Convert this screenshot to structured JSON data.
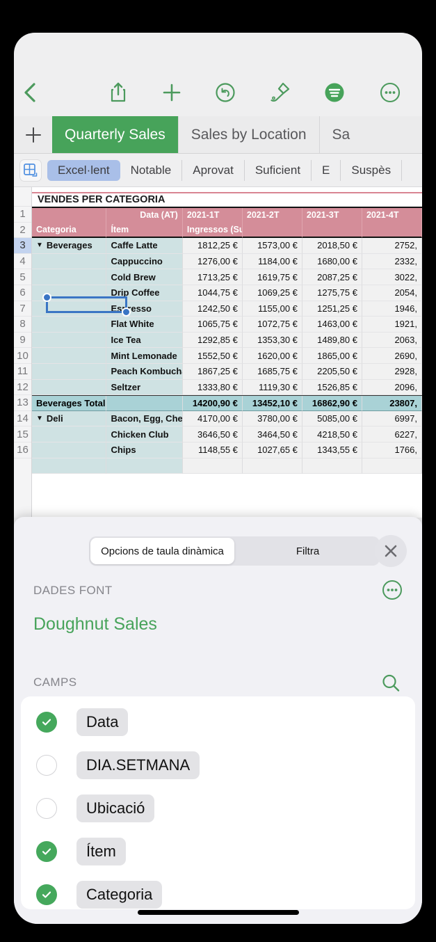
{
  "toolbar": {
    "back_icon": "chevron-left-icon",
    "share_icon": "share-icon",
    "add_icon": "plus-icon",
    "undo_icon": "undo-icon",
    "brush_icon": "paintbrush-icon",
    "format_icon": "format-icon",
    "more_icon": "more-circle-icon"
  },
  "sheet_tabs": {
    "add_label": "+",
    "tabs": [
      {
        "label": "Quarterly Sales",
        "active": true
      },
      {
        "label": "Sales by Location",
        "active": false
      },
      {
        "label": "Sa",
        "active": false
      }
    ]
  },
  "style_bar": {
    "table_icon": "table-insert-icon",
    "styles": [
      {
        "label": "Excel·lent",
        "selected": true
      },
      {
        "label": "Notable",
        "selected": false
      },
      {
        "label": "Aprovat",
        "selected": false
      },
      {
        "label": "Suficient",
        "selected": false
      },
      {
        "label": "E",
        "selected": false
      },
      {
        "label": "Suspès",
        "selected": false
      }
    ]
  },
  "spreadsheet": {
    "title": "VENDES PER CATEGORIA",
    "row_numbers": [
      "1",
      "2",
      "3",
      "4",
      "5",
      "6",
      "7",
      "8",
      "9",
      "10",
      "11",
      "12",
      "13",
      "14",
      "15",
      "16"
    ],
    "selected_row": "3",
    "header_row_1": {
      "data_label": "Data (AT)",
      "quarters": [
        "2021-1T",
        "2021-2T",
        "2021-3T",
        "2021-4T"
      ]
    },
    "header_row_2": {
      "category": "Categoria",
      "item": "Ítem",
      "measure": "Ingressos (Suma)"
    },
    "rows": [
      {
        "type": "group",
        "category": "Beverages",
        "item": "Caffe Latte",
        "values": [
          "1812,25 €",
          "1573,00 €",
          "2018,50 €",
          "2752,"
        ]
      },
      {
        "type": "data",
        "category": "",
        "item": "Cappuccino",
        "values": [
          "1276,00 €",
          "1184,00 €",
          "1680,00 €",
          "2332,"
        ]
      },
      {
        "type": "data",
        "category": "",
        "item": "Cold Brew",
        "values": [
          "1713,25 €",
          "1619,75 €",
          "2087,25 €",
          "3022,"
        ]
      },
      {
        "type": "data",
        "category": "",
        "item": "Drip Coffee",
        "values": [
          "1044,75 €",
          "1069,25 €",
          "1275,75 €",
          "2054,"
        ]
      },
      {
        "type": "data",
        "category": "",
        "item": "Espresso",
        "values": [
          "1242,50 €",
          "1155,00 €",
          "1251,25 €",
          "1946,"
        ]
      },
      {
        "type": "data",
        "category": "",
        "item": "Flat White",
        "values": [
          "1065,75 €",
          "1072,75 €",
          "1463,00 €",
          "1921,"
        ]
      },
      {
        "type": "data",
        "category": "",
        "item": "Ice Tea",
        "values": [
          "1292,85 €",
          "1353,30 €",
          "1489,80 €",
          "2063,"
        ]
      },
      {
        "type": "data",
        "category": "",
        "item": "Mint Lemonade",
        "values": [
          "1552,50 €",
          "1620,00 €",
          "1865,00 €",
          "2690,"
        ]
      },
      {
        "type": "data",
        "category": "",
        "item": "Peach Kombucha",
        "values": [
          "1867,25 €",
          "1685,75 €",
          "2205,50 €",
          "2928,"
        ]
      },
      {
        "type": "data",
        "category": "",
        "item": "Seltzer",
        "values": [
          "1333,80 €",
          "1119,30 €",
          "1526,85 €",
          "2096,"
        ]
      },
      {
        "type": "total",
        "category": "Beverages Total",
        "item": "",
        "values": [
          "14200,90 €",
          "13452,10 €",
          "16862,90 €",
          "23807,"
        ]
      },
      {
        "type": "group",
        "category": "Deli",
        "item": "Bacon, Egg, Cheese",
        "values": [
          "4170,00 €",
          "3780,00 €",
          "5085,00 €",
          "6997,"
        ]
      },
      {
        "type": "data",
        "category": "",
        "item": "Chicken Club",
        "values": [
          "3646,50 €",
          "3464,50 €",
          "4218,50 €",
          "6227,"
        ]
      },
      {
        "type": "data",
        "category": "",
        "item": "Chips",
        "values": [
          "1148,55 €",
          "1027,65 €",
          "1343,55 €",
          "1766,"
        ]
      }
    ]
  },
  "panel": {
    "segments": [
      {
        "label": "Opcions de taula dinàmica",
        "active": true
      },
      {
        "label": "Filtra",
        "active": false
      }
    ],
    "close_icon": "close-icon",
    "source_section_label": "DADES FONT",
    "source_more_icon": "more-circle-icon",
    "source_name": "Doughnut Sales",
    "fields_section_label": "CAMPS",
    "fields_search_icon": "search-icon",
    "fields": [
      {
        "label": "Data",
        "checked": true
      },
      {
        "label": "DIA.SETMANA",
        "checked": false
      },
      {
        "label": "Ubicació",
        "checked": false
      },
      {
        "label": "Ítem",
        "checked": true
      },
      {
        "label": "Categoria",
        "checked": true
      }
    ]
  },
  "colors": {
    "accent_green": "#47a35a",
    "header_pink": "#d48d99",
    "group_teal": "#cfe2e3",
    "total_teal": "#a9d2d6",
    "selection_blue": "#3a75c4",
    "style_selected": "#a9bfe8"
  }
}
